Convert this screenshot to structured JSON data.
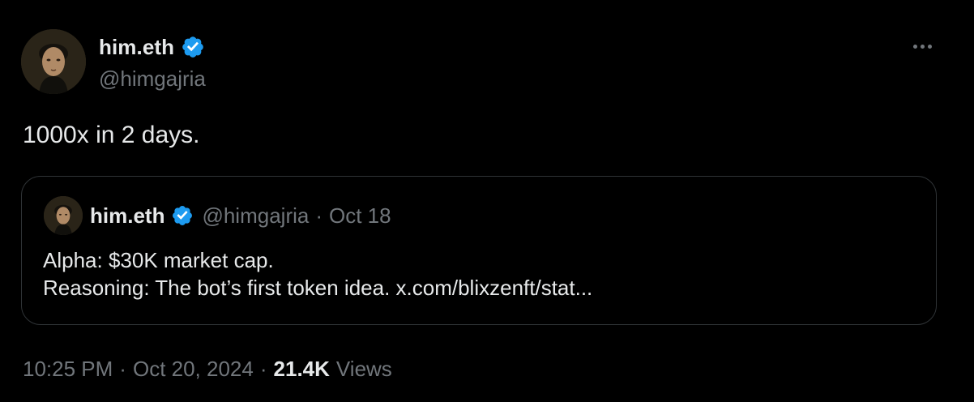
{
  "author": {
    "display_name": "him.eth",
    "handle": "@himgajria",
    "verified_icon": "verified-badge-icon"
  },
  "tweet": {
    "text": "1000x in 2 days.",
    "time": "10:25 PM",
    "separator": "·",
    "date": "Oct 20, 2024",
    "views_count": "21.4K",
    "views_label": "Views"
  },
  "quoted_tweet": {
    "display_name": "him.eth",
    "handle": "@himgajria",
    "separator": "·",
    "date": "Oct 18",
    "lines": [
      "Alpha: $30K market cap.",
      "Reasoning: The bot’s first token idea. x.com/blixzenft/stat..."
    ]
  },
  "colors": {
    "background": "#000000",
    "text": "#e7e9ea",
    "secondary_text": "#71767b",
    "verified_blue": "#1d9bf0",
    "border": "#2f3336"
  }
}
